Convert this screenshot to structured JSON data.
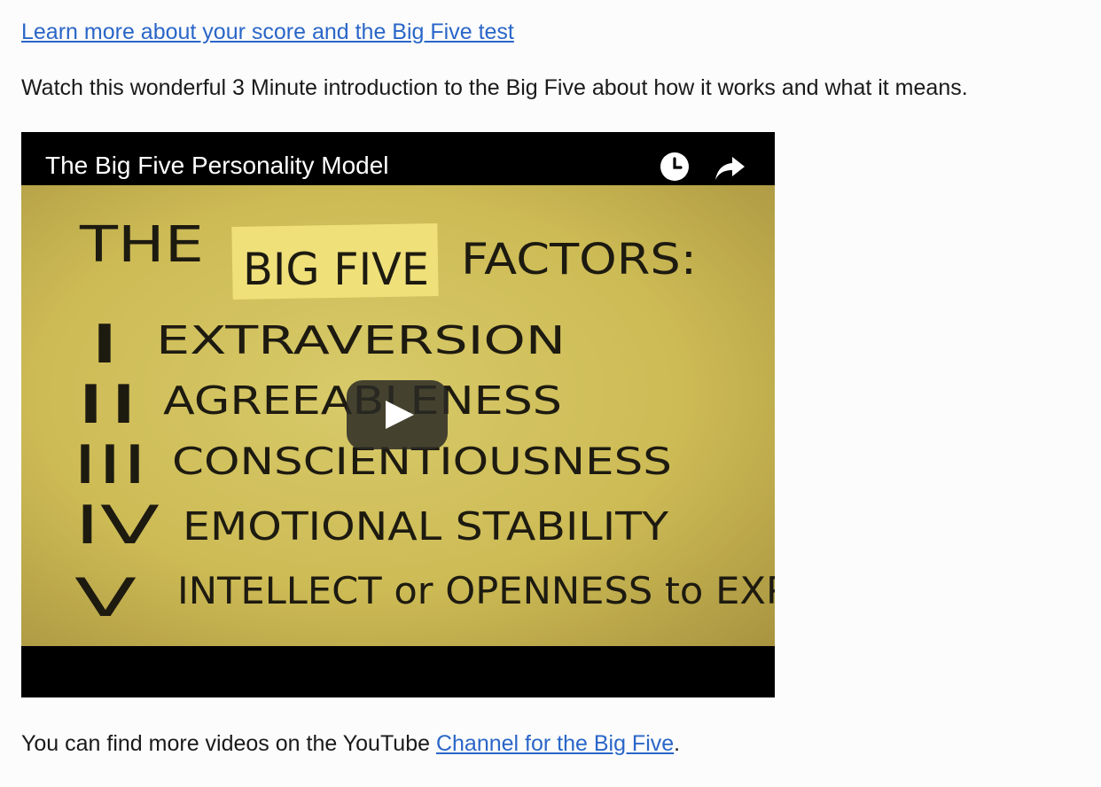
{
  "links": {
    "learn_more": "Learn more about your score and the Big Five test"
  },
  "intro_text": "Watch this wonderful 3 Minute introduction to the Big Five about how it works and what it means.",
  "video": {
    "title": "The Big Five Personality Model",
    "controls": {
      "watch_later_icon": "clock-icon",
      "share_icon": "share-arrow-icon",
      "play_icon": "play-icon"
    },
    "frame": {
      "heading_left": "THE",
      "note": "BIG FIVE",
      "heading_right": "FACTORS:",
      "factors": [
        {
          "numeral": "I",
          "text": "EXTRAVERSION"
        },
        {
          "numeral": "II",
          "text": "AGREEABLENESS"
        },
        {
          "numeral": "III",
          "text": "CONSCIENTIOUSNESS"
        },
        {
          "numeral": "IV",
          "text": "EMOTIONAL STABILITY"
        },
        {
          "numeral": "V",
          "text": "INTELLECT or OPENNESS to EXP"
        }
      ]
    }
  },
  "outro": {
    "prefix": "You can find more videos on the YouTube ",
    "link": "Channel for the Big Five",
    "suffix": "."
  }
}
